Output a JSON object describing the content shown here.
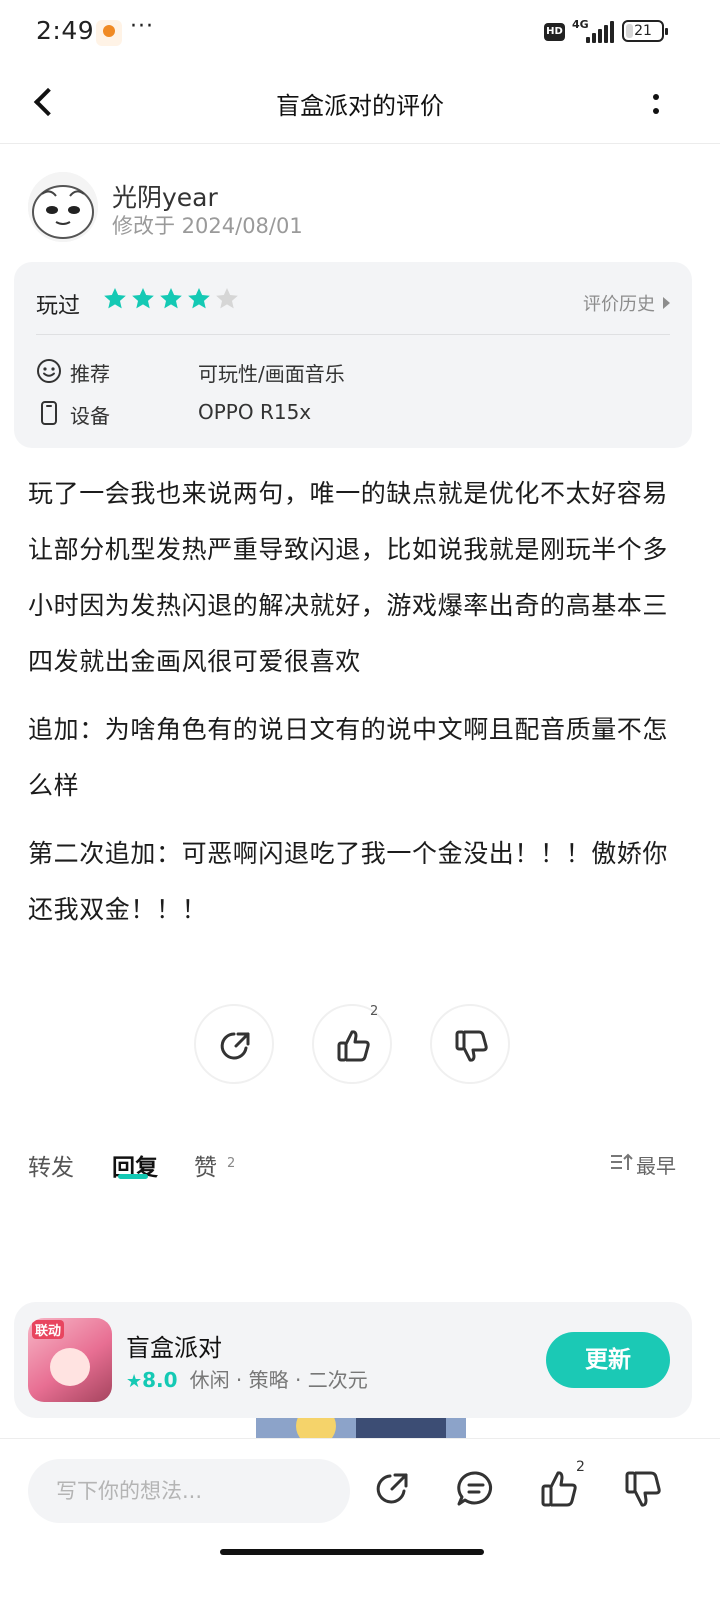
{
  "status_bar": {
    "time": "2:49",
    "more": "···",
    "hd": "HD",
    "network": "4G",
    "battery": "21",
    "battery_level": 0.21
  },
  "header": {
    "title": "盲盒派对的评价"
  },
  "author": {
    "name": "光阴year",
    "edited": "修改于 2024/08/01"
  },
  "rating_card": {
    "played_label": "玩过",
    "stars_filled": 4,
    "stars_total": 5,
    "star_color": "#14c9b4",
    "star_empty_color": "#d6d6d6",
    "history_label": "评价历史",
    "rows": [
      {
        "icon": "smile-icon",
        "label": "推荐",
        "value": "可玩性/画面音乐"
      },
      {
        "icon": "phone-icon",
        "label": "设备",
        "value": "OPPO R15x"
      }
    ]
  },
  "review": {
    "paragraphs": [
      "玩了一会我也来说两句，唯一的缺点就是优化不太好容易让部分机型发热严重导致闪退，比如说我就是刚玩半个多小时因为发热闪退的解决就好，游戏爆率出奇的高基本三四发就出金画风很可爱很喜欢",
      "追加：为啥角色有的说日文有的说中文啊且配音质量不怎么样",
      "第二次追加：可恶啊闪退吃了我一个金没出！！！傲娇你还我双金！！！"
    ]
  },
  "actions": {
    "like_count": "2"
  },
  "tabs": {
    "items": [
      "转发",
      "回复",
      "赞"
    ],
    "active": "回复",
    "like_count": "2",
    "sort_label": "最早"
  },
  "game": {
    "name": "盲盒派对",
    "icon_tag": "联动",
    "star": "★",
    "score": "8.0",
    "tags": "休闲 · 策略 · 二次元",
    "button": "更新",
    "accent": "#1bc9b5"
  },
  "bottom_bar": {
    "placeholder": "写下你的想法...",
    "like_count": "2"
  }
}
